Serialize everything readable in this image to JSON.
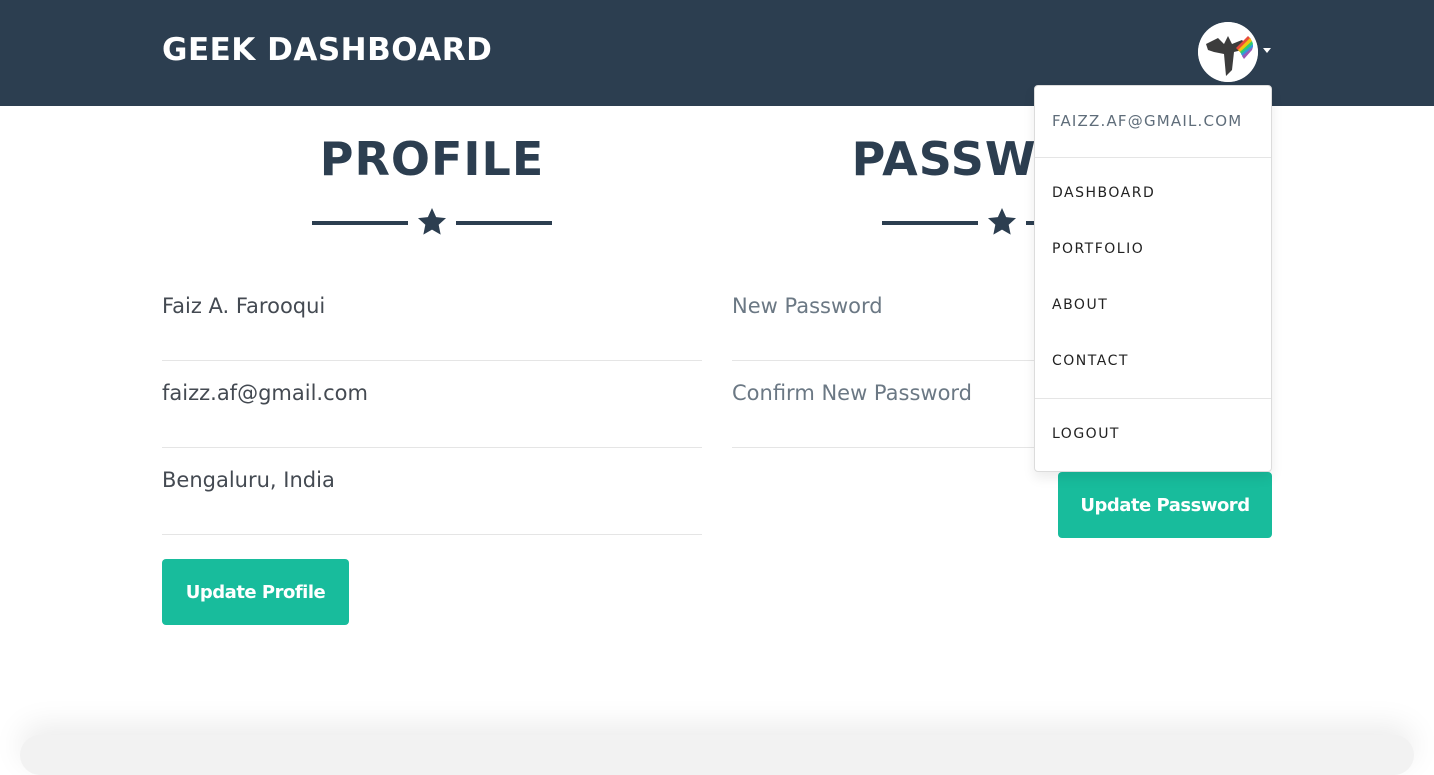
{
  "navbar": {
    "brand": "GEEK DASHBOARD",
    "avatar_alt": "user-avatar",
    "colors": {
      "background": "#2c3e50",
      "text": "#ffffff"
    }
  },
  "user_menu": {
    "header": "FAIZZ.AF@GMAIL.COM",
    "items": [
      {
        "label": "DASHBOARD"
      },
      {
        "label": "PORTFOLIO"
      },
      {
        "label": "ABOUT"
      },
      {
        "label": "CONTACT"
      }
    ],
    "logout": "LOGOUT"
  },
  "profile": {
    "title": "PROFILE",
    "fields": [
      {
        "name": "name",
        "value": "Faiz A. Farooqui"
      },
      {
        "name": "email",
        "value": "faizz.af@gmail.com"
      },
      {
        "name": "location",
        "value": "Bengaluru, India"
      }
    ],
    "submit_label": "Update Profile"
  },
  "password": {
    "title": "PASSWORD",
    "fields": [
      {
        "name": "new-password",
        "placeholder": "New Password",
        "value": ""
      },
      {
        "name": "confirm-password",
        "placeholder": "Confirm New Password",
        "value": ""
      }
    ],
    "submit_label": "Update Password"
  },
  "theme": {
    "primary": "#2c3e50",
    "accent": "#18bc9c",
    "divider": "#e5e5e5"
  }
}
